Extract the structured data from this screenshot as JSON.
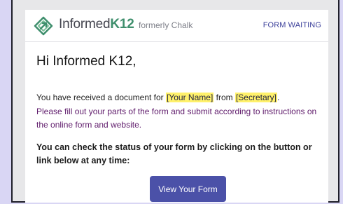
{
  "header": {
    "brand_main": "Informed",
    "brand_k12": "K12",
    "formerly": "formerly Chalk",
    "status": "FORM WAITING",
    "accent": "#3f8f6d"
  },
  "body": {
    "greeting": "Hi Informed K12,",
    "received_prefix": "You have received a document for ",
    "recipient_field": "[Your Name]",
    "from_word": " from ",
    "sender_field": "[Secretary]",
    "received_suffix": ".",
    "instruction": "Please fill out your parts of the form and submit according to instructions on the online form and website.",
    "status_note": "You can check the status of your form by clicking on the button or link below at any time:",
    "button_label": "View Your Form"
  }
}
